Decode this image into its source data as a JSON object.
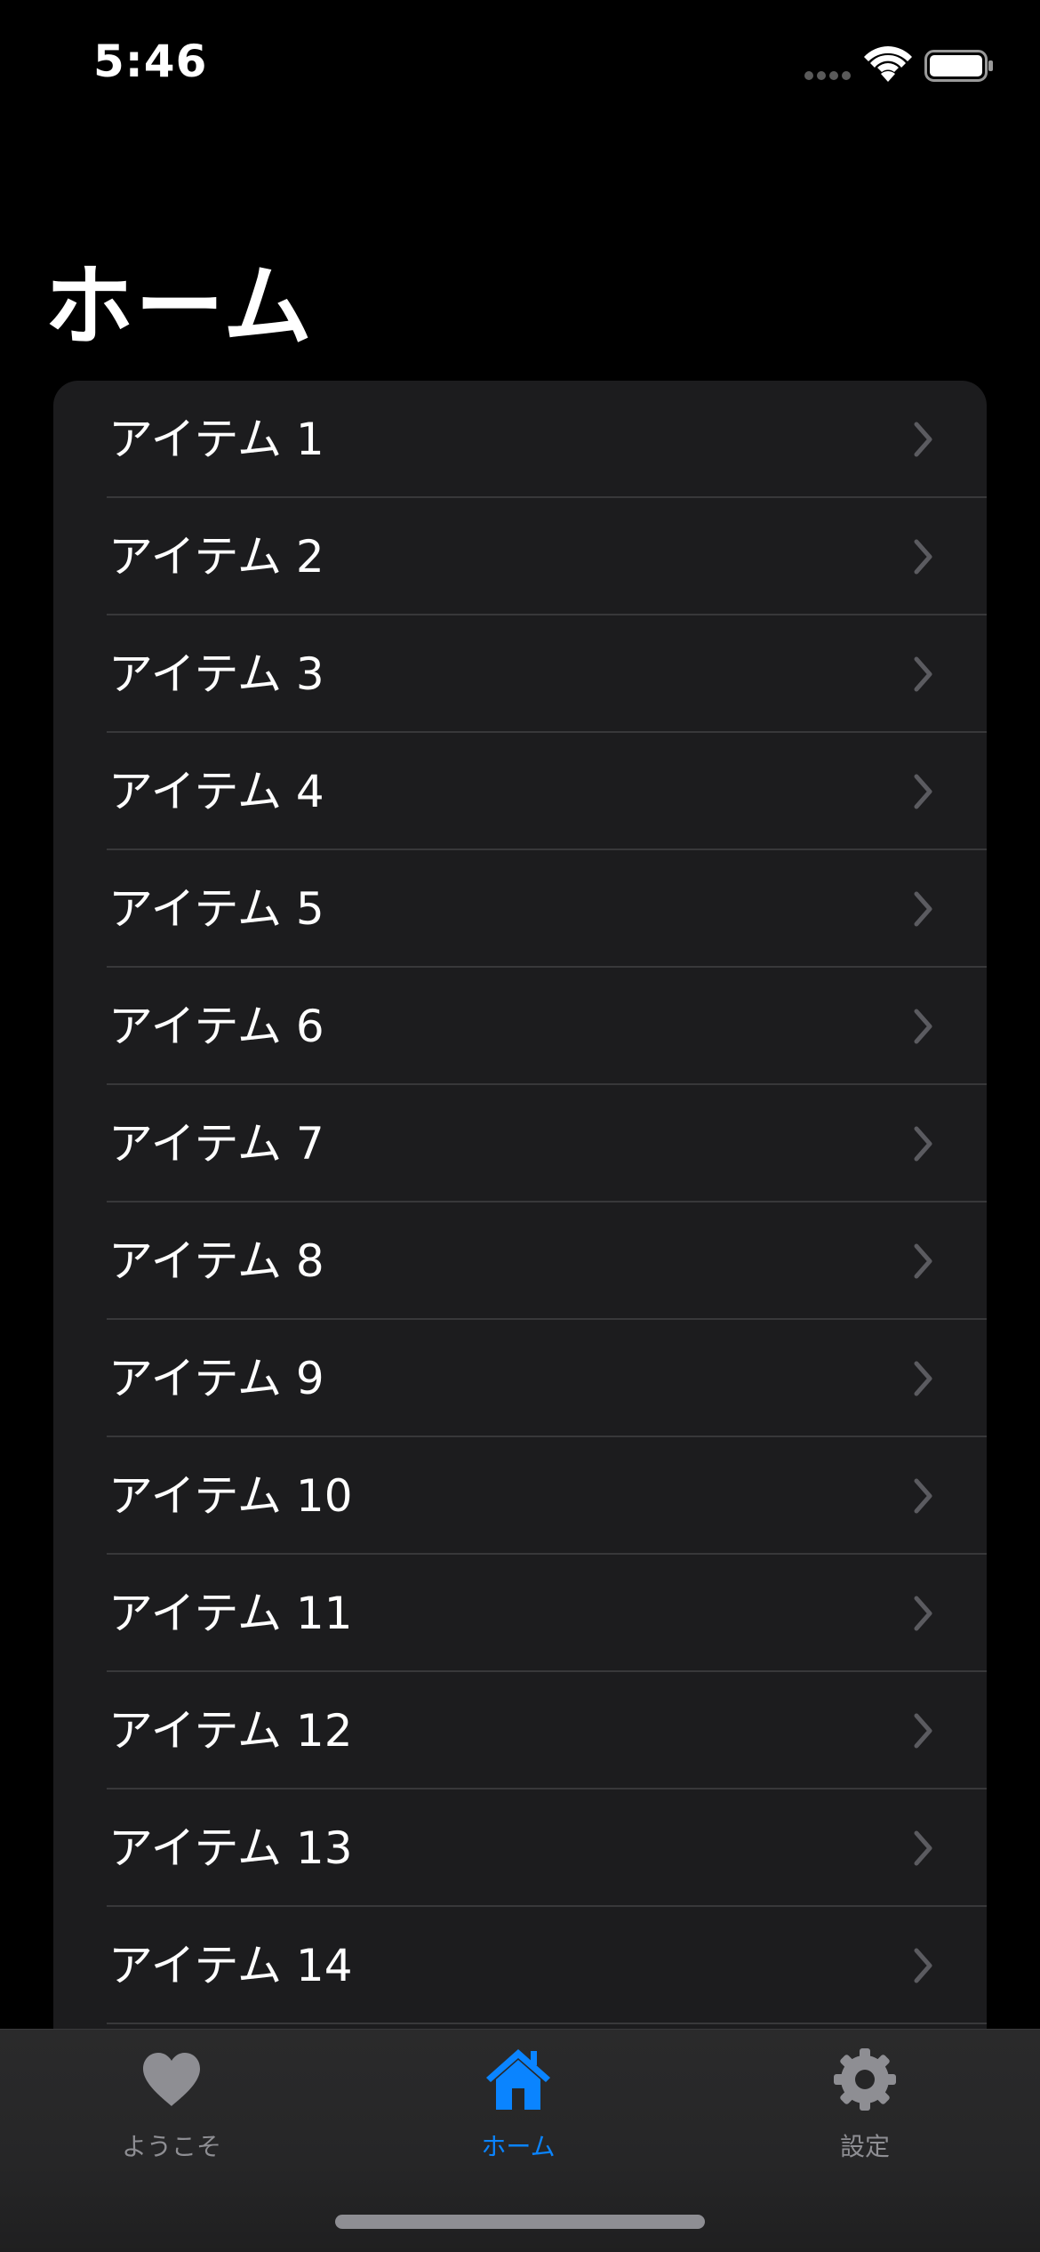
{
  "status_bar": {
    "time": "5:46"
  },
  "page": {
    "title": "ホーム"
  },
  "list": {
    "items": [
      {
        "label": "アイテム 1"
      },
      {
        "label": "アイテム 2"
      },
      {
        "label": "アイテム 3"
      },
      {
        "label": "アイテム 4"
      },
      {
        "label": "アイテム 5"
      },
      {
        "label": "アイテム 6"
      },
      {
        "label": "アイテム 7"
      },
      {
        "label": "アイテム 8"
      },
      {
        "label": "アイテム 9"
      },
      {
        "label": "アイテム 10"
      },
      {
        "label": "アイテム 11"
      },
      {
        "label": "アイテム 12"
      },
      {
        "label": "アイテム 13"
      },
      {
        "label": "アイテム 14"
      }
    ],
    "row_icon": "chevron-right-icon"
  },
  "tab_bar": {
    "tabs": [
      {
        "label": "ようこそ",
        "icon": "heart-icon",
        "selected": false
      },
      {
        "label": "ホーム",
        "icon": "house-icon",
        "selected": true
      },
      {
        "label": "設定",
        "icon": "gear-icon",
        "selected": false
      }
    ]
  },
  "colors": {
    "background": "#000000",
    "card": "#1c1c1e",
    "separator": "#38383a",
    "chevron": "#5b5b60",
    "accent": "#0a84ff",
    "inactive": "#8e8e93"
  }
}
